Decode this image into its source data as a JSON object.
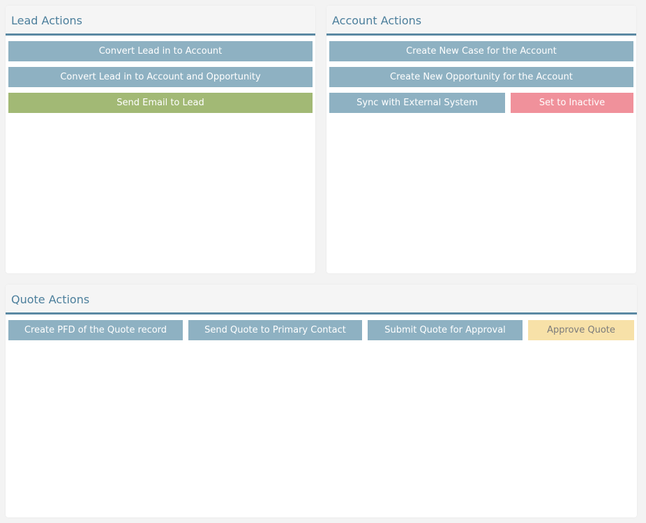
{
  "lead": {
    "title": "Lead Actions",
    "buttons": {
      "convert_account": "Convert Lead in to Account",
      "convert_account_opportunity": "Convert Lead in to Account and Opportunity",
      "send_email": "Send Email to Lead"
    }
  },
  "account": {
    "title": "Account Actions",
    "buttons": {
      "create_case": "Create New Case for the Account",
      "create_opportunity": "Create New Opportunity for the Account",
      "sync_external": "Sync with External System",
      "set_inactive": "Set to Inactive"
    }
  },
  "quote": {
    "title": "Quote Actions",
    "buttons": {
      "create_pdf": "Create PFD of the Quote record",
      "send_primary": "Send Quote to Primary Contact",
      "submit_approval": "Submit Quote for Approval",
      "approve": "Approve Quote"
    }
  },
  "colors": {
    "header_text": "#4c7f9c",
    "header_border": "#5b89a3",
    "button_blue": "#8eb1c2",
    "button_green": "#a2b975",
    "button_red": "#f0919b",
    "button_yellow": "#f7e1a8"
  }
}
